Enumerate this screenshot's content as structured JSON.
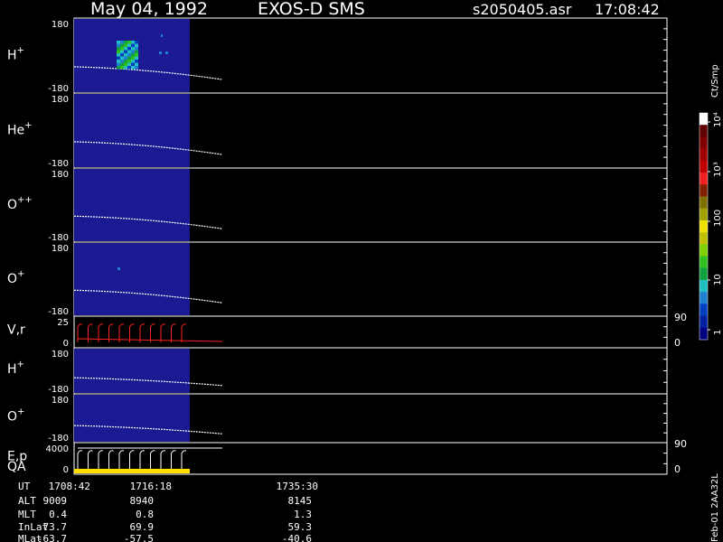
{
  "header": {
    "date": "May 04, 1992",
    "instrument": "EXOS-D SMS",
    "file": "s2050405.asr",
    "time": "17:08:42"
  },
  "colorbar": {
    "unit": "Ct/Smp",
    "ticks": [
      "1",
      "10",
      "100",
      "10³",
      "10⁴"
    ],
    "colors": [
      "#000080",
      "#0020a0",
      "#0040c0",
      "#2080d0",
      "#20c0c0",
      "#10a040",
      "#30c020",
      "#80d000",
      "#c0c000",
      "#f0e000",
      "#a0a000",
      "#807000",
      "#802000",
      "#f02020",
      "#c00000",
      "#a00000",
      "#800000",
      "#600000",
      "#ffffff"
    ]
  },
  "footer": {
    "labels": [
      "UT",
      "ALT",
      "MLT",
      "InLat",
      "MLat"
    ],
    "columns": [
      {
        "values": [
          "1708:42",
          "9009",
          "0.4",
          "73.7",
          "-63.7"
        ]
      },
      {
        "values": [
          "1716:18",
          "8940",
          "0.8",
          "69.9",
          "-57.5"
        ]
      },
      {
        "values": [
          "1735:30",
          "8145",
          "1.3",
          "59.3",
          "-40.6"
        ]
      }
    ],
    "side_label": "Feb-01 2AA32L"
  },
  "chart_data": {
    "type": "heatmap",
    "title": "May 04, 1992 EXOS-D SMS",
    "x": [
      "1708:42",
      "1716:18",
      "1735:30"
    ],
    "panels": [
      {
        "name": "H+",
        "label": "H",
        "sup": "+",
        "ymax": "180",
        "ymin": "-180",
        "kind": "spectrogram"
      },
      {
        "name": "He+",
        "label": "He",
        "sup": "+",
        "ymax": "180",
        "ymin": "-180",
        "kind": "spectrogram"
      },
      {
        "name": "O++",
        "label": "O",
        "sup": "++",
        "ymax": "180",
        "ymin": "-180",
        "kind": "spectrogram"
      },
      {
        "name": "O+",
        "label": "O",
        "sup": "+",
        "ymax": "180",
        "ymin": "-180",
        "kind": "spectrogram"
      },
      {
        "name": "V,r",
        "label": "V,r",
        "sup": "",
        "ymax": "25",
        "ymin": "0",
        "right_top": "90",
        "right_bottom": "0",
        "kind": "line"
      },
      {
        "name": "H+",
        "label": "H",
        "sup": "+",
        "ymax": "180",
        "ymin": "-180",
        "kind": "spectrogram"
      },
      {
        "name": "O+",
        "label": "O",
        "sup": "+",
        "ymax": "180",
        "ymin": "-180",
        "kind": "spectrogram"
      },
      {
        "name": "E,p QA",
        "label": "E,p",
        "label2": "QA",
        "sup": "",
        "ymax": "4000",
        "ymin": "0",
        "right_top": "90",
        "right_bottom": "0",
        "kind": "line"
      }
    ],
    "colorscale": [
      "1",
      "10",
      "100",
      "10³",
      "10⁴"
    ],
    "colorscale_unit": "Ct/Smp"
  }
}
